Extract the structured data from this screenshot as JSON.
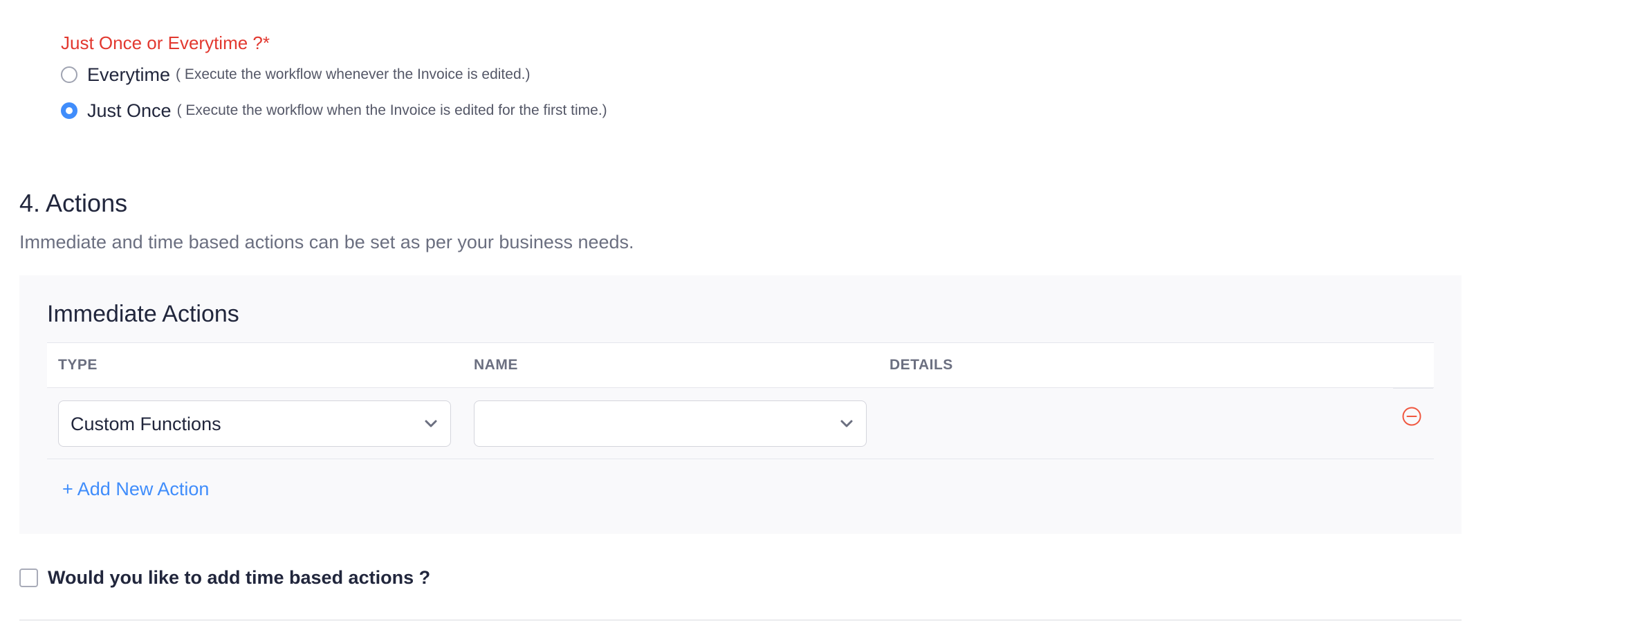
{
  "frequency": {
    "label": "Just Once or Everytime ?*",
    "options": [
      {
        "title": "Everytime",
        "hint": "( Execute the workflow whenever the Invoice is edited.)",
        "selected": false
      },
      {
        "title": "Just Once",
        "hint": "( Execute the workflow when the Invoice is edited for the first time.)",
        "selected": true
      }
    ]
  },
  "actions": {
    "title": "4. Actions",
    "description": "Immediate and time based actions can be set as per your business needs."
  },
  "immediate": {
    "title": "Immediate Actions",
    "columns": {
      "type": "TYPE",
      "name": "NAME",
      "details": "DETAILS"
    },
    "rows": [
      {
        "type": "Custom Functions",
        "name": "",
        "details": ""
      }
    ],
    "add_label": "+ Add New Action"
  },
  "time_based": {
    "label": "Would you like to add time based actions ?",
    "checked": false
  },
  "colors": {
    "required_label": "#e2382f",
    "accent": "#408dfb",
    "remove_icon": "#f0573f"
  },
  "icons": {
    "dropdown": "chevron-down-icon",
    "remove": "minus-circle-icon"
  }
}
